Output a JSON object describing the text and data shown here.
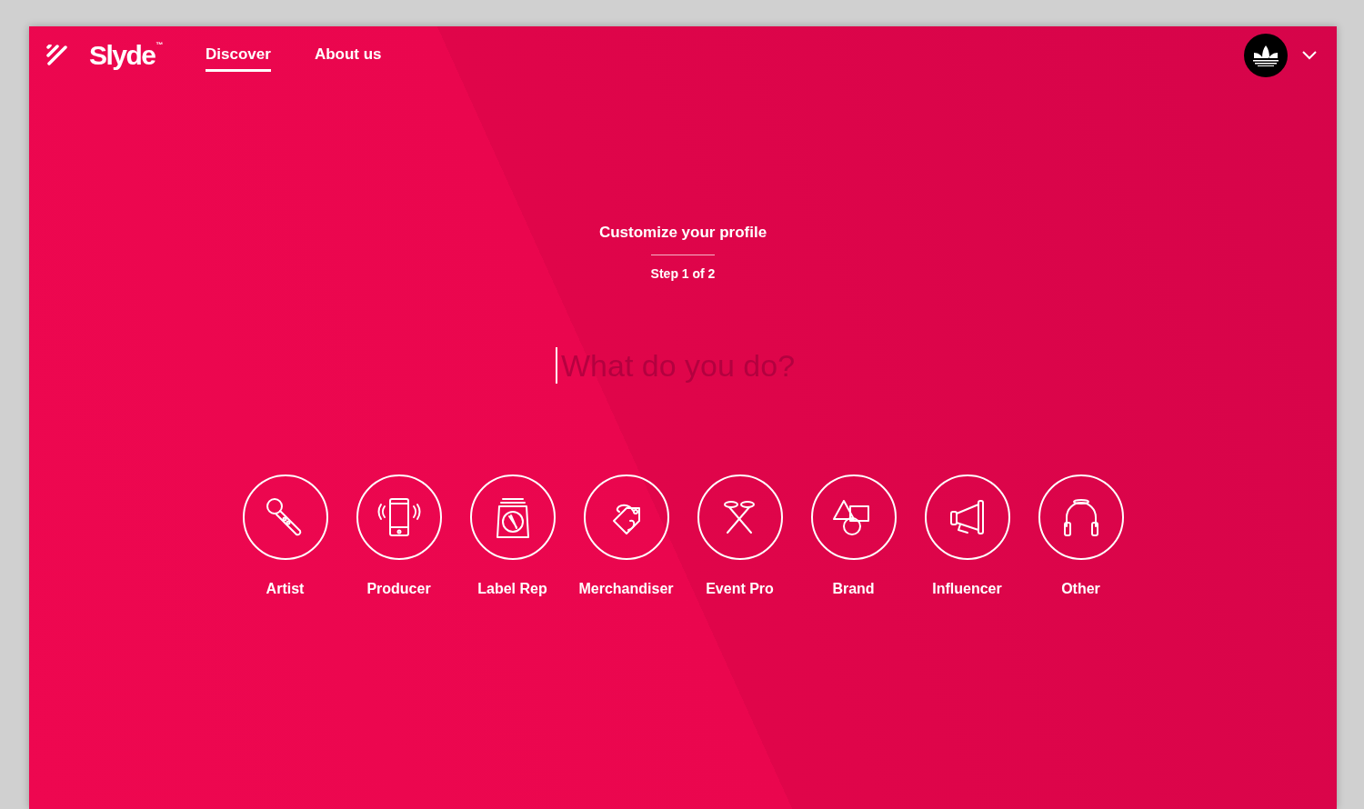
{
  "header": {
    "logo": {
      "name": "Slyde",
      "trademark": "™"
    },
    "nav": [
      {
        "label": "Discover",
        "selected": true
      },
      {
        "label": "About us",
        "selected": false
      }
    ]
  },
  "setup": {
    "title": "Customize your profile",
    "step": "Step 1 of 2",
    "question": {
      "placeholder": "What do you do?"
    }
  },
  "roles": [
    {
      "kind": "microphone",
      "label": "Artist"
    },
    {
      "kind": "phone",
      "label": "Producer"
    },
    {
      "kind": "records",
      "label": "Label Rep"
    },
    {
      "kind": "tag",
      "label": "Merchandiser"
    },
    {
      "kind": "tickets",
      "label": "Event Pro"
    },
    {
      "kind": "shapes",
      "label": "Brand"
    },
    {
      "kind": "megaphone",
      "label": "Influencer"
    },
    {
      "kind": "headphones",
      "label": "Other"
    }
  ]
}
